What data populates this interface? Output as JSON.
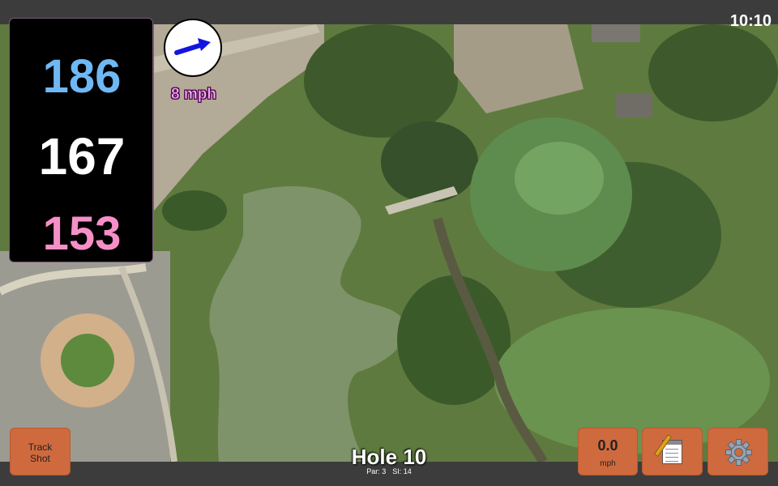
{
  "status_bar": {
    "clock": "10:10"
  },
  "distances": {
    "back": "186",
    "middle": "167",
    "front": "153"
  },
  "wind": {
    "speed": "8 mph",
    "direction_icon": "arrow-right-icon"
  },
  "track_shot": {
    "line1": "Track",
    "line2": "Shot"
  },
  "hole": {
    "title": "Hole 10",
    "par": "Par: 3",
    "si": "SI: 14"
  },
  "speed": {
    "value": "0.0",
    "unit": "mph"
  },
  "icons": {
    "notes": "notepad-icon",
    "settings": "gear-icon"
  },
  "colors": {
    "back": "#6fb8f4",
    "middle": "#ffffff",
    "front": "#f78fc7",
    "button": "#cf6a3f",
    "wind_text": "#f0b0ef"
  }
}
